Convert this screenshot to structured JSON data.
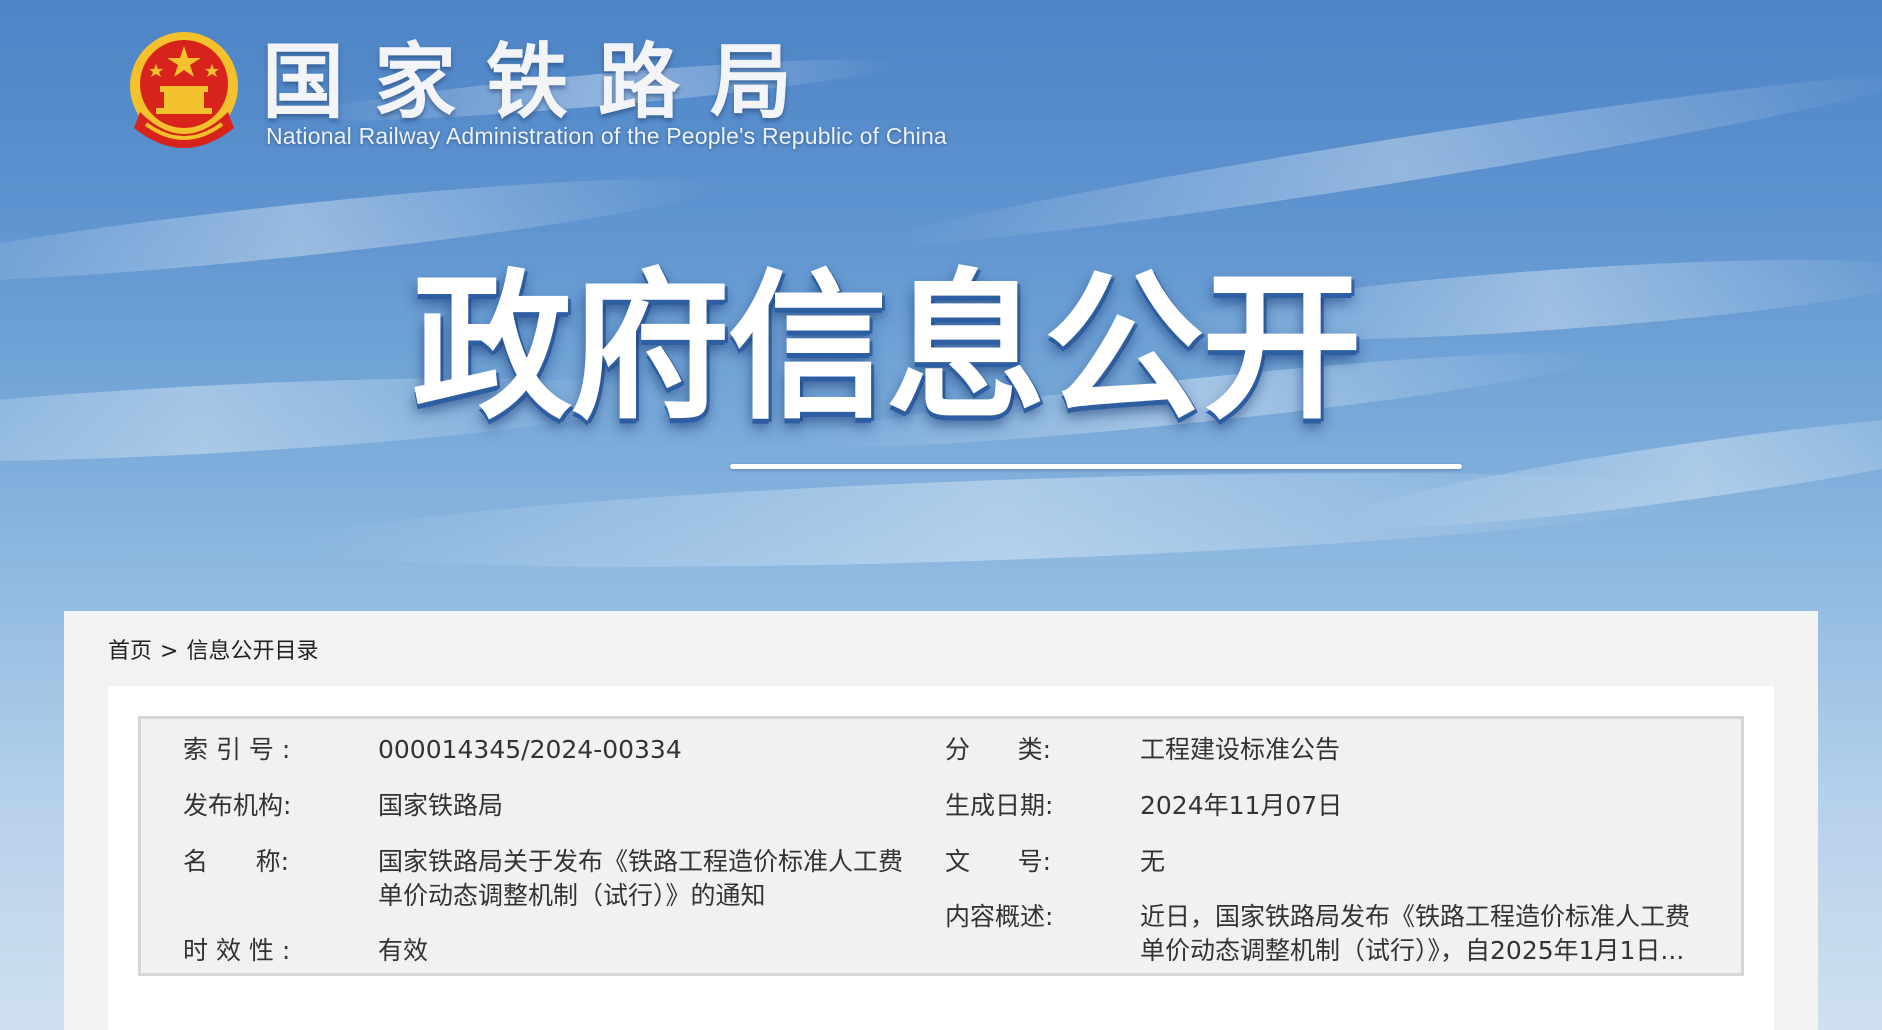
{
  "site": {
    "name_cn": "国家铁路局",
    "name_en": "National Railway Administration of the People's Republic of China"
  },
  "banner": {
    "headline": "政府信息公开"
  },
  "breadcrumb": {
    "home": "首页",
    "separator": ">",
    "current": "信息公开目录"
  },
  "meta": {
    "index_label": "索 引 号 :",
    "index_value": "000014345/2024-00334",
    "category_label": "分      类:",
    "category_value": "工程建设标准公告",
    "publisher_label": "发布机构:",
    "publisher_value": "国家铁路局",
    "date_label": "生成日期:",
    "date_value": "2024年11月07日",
    "title_label": "名      称:",
    "title_value": "国家铁路局关于发布《铁路工程造价标准人工费单价动态调整机制（试行）》的通知",
    "docno_label": "文      号:",
    "docno_value": "无",
    "summary_label": "内容概述:",
    "summary_value": "近日，国家铁路局发布《铁路工程造价标准人工费单价动态调整机制（试行）》，自2025年1月1日...",
    "validity_label": "时 效 性 :",
    "validity_value": "有效"
  },
  "colors": {
    "sky_top": "#4d84c6",
    "sky_bottom": "#cfe0f1",
    "panel_bg": "#f2f2f2",
    "meta_bg": "#f1f1f1",
    "emblem_red": "#d8231c",
    "emblem_gold": "#f3c12b"
  }
}
